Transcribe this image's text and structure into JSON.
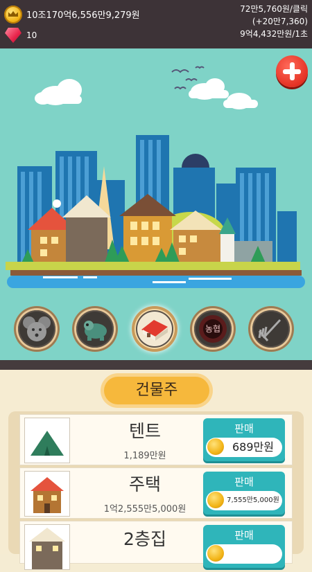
{
  "header": {
    "money": "10조170억6,556만9,279원",
    "gems": "10",
    "per_click": "72만5,760원/클릭",
    "bonus": "(+20만7,360)",
    "per_second": "9억4,432만원/1초"
  },
  "scene": {
    "sky_color": "#7fd3c7",
    "water_color": "#3aa5e0"
  },
  "tabs": [
    {
      "name": "mouse",
      "icon": "mouse-icon"
    },
    {
      "name": "turtle",
      "icon": "turtle-icon"
    },
    {
      "name": "building",
      "icon": "house-icon",
      "active": true
    },
    {
      "name": "farm",
      "icon": "farm-emblem-icon",
      "label": "농협"
    },
    {
      "name": "tools",
      "icon": "rake-icon"
    }
  ],
  "panel": {
    "title": "건물주",
    "items": [
      {
        "name": "텐트",
        "price": "1,189만원",
        "sell_label": "판매",
        "sell_value": "689만원",
        "icon": "tent-icon"
      },
      {
        "name": "주택",
        "price": "1억2,555만5,000원",
        "sell_label": "판매",
        "sell_value": "7,555만5,000원",
        "icon": "house-icon"
      },
      {
        "name": "2층집",
        "price": "",
        "sell_label": "판매",
        "sell_value": "",
        "icon": "two-story-house-icon"
      }
    ]
  }
}
